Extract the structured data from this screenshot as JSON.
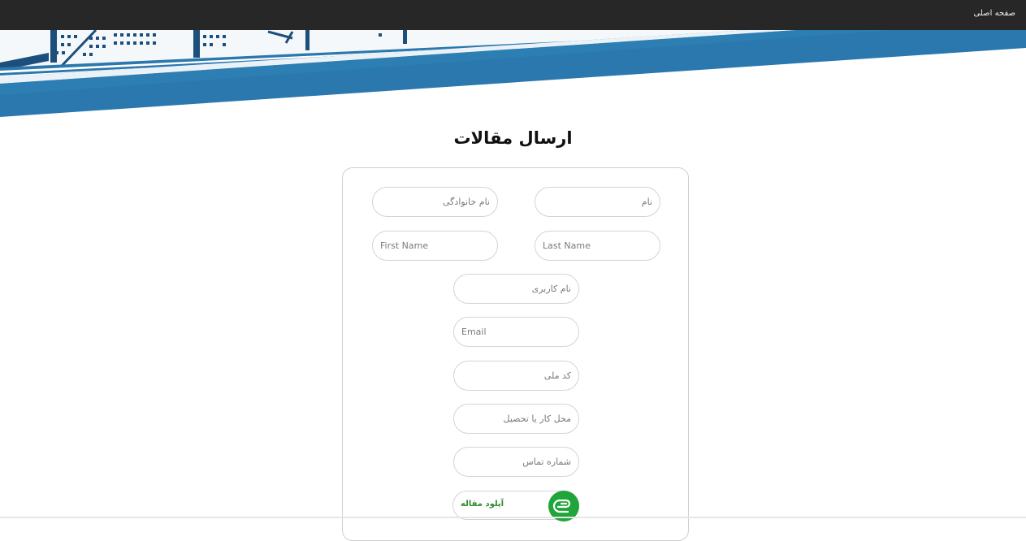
{
  "topbar": {
    "home_label": "صفحه اصلی"
  },
  "page": {
    "title": "ارسال مقالات"
  },
  "form": {
    "last_name_fa_placeholder": "نام خانوادگی",
    "first_name_fa_placeholder": "نام",
    "first_name_en_placeholder": "First Name",
    "last_name_en_placeholder": "Last Name",
    "username_placeholder": "نام کاربری",
    "email_placeholder": "Email",
    "national_code_placeholder": "کد ملی",
    "workplace_placeholder": "محل کار یا تحصیل",
    "phone_placeholder": "شماره تماس",
    "upload_label": "آپلود مقاله"
  },
  "icons": {
    "upload_button": "paperclip-icon",
    "banner": "city-skyline"
  },
  "colors": {
    "topbar": "#272727",
    "banner_blue": "#2a78ad",
    "banner_navy": "#1d4f7c",
    "upload_green": "#1fa53a",
    "upload_text": "#2e8b2e"
  }
}
